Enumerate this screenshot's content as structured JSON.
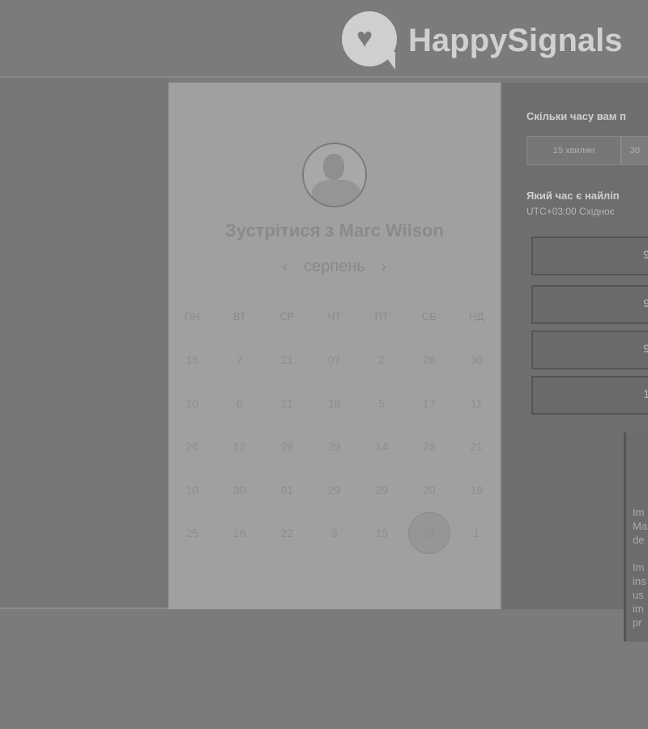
{
  "brand": {
    "name": "HappySignals",
    "logo_icon": "heart-speech-bubble-icon"
  },
  "booking": {
    "title": "Зустрітися з Marc Wilson",
    "month": "серпень",
    "prev_icon": "chevron-left-icon",
    "next_icon": "chevron-right-icon",
    "weekdays": [
      "ПН",
      "ВТ",
      "СР",
      "ЧТ",
      "ПТ",
      "СБ",
      "НД"
    ],
    "weeks": [
      [
        "16",
        "7",
        "21",
        "07",
        "2",
        "28",
        "30"
      ],
      [
        "10",
        "6",
        "21",
        "18",
        "5",
        "17",
        "11"
      ],
      [
        "26",
        "12",
        "29",
        "29",
        "14",
        "28",
        "21"
      ],
      [
        "10",
        "30",
        "01",
        "29",
        "29",
        "20",
        "19"
      ],
      [
        "25",
        "16",
        "22",
        "9",
        "15",
        "14",
        "1"
      ]
    ],
    "selected_day": "14"
  },
  "right_panel": {
    "duration_question": "Скільки часу вам п",
    "duration_options": [
      "15 хвилин",
      "30"
    ],
    "time_question": "Який час є найліп",
    "timezone": "UTC+03:00 Східноє",
    "slots": [
      "9",
      "9",
      "9",
      "1"
    ],
    "tooltip_lines": [
      "Im",
      "Ma",
      "de",
      "",
      "Im",
      "ins",
      "us",
      "im",
      "pr"
    ]
  }
}
